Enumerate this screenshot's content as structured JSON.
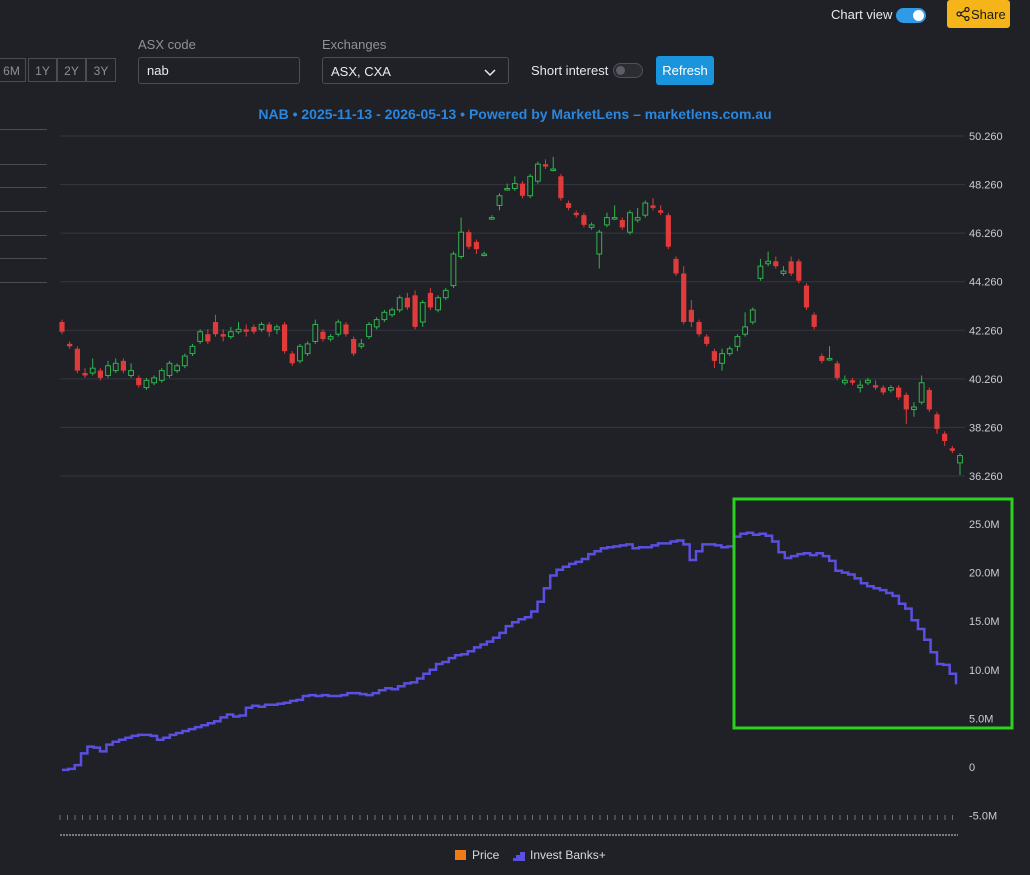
{
  "header": {
    "chart_view_label": "Chart view",
    "share_label": "Share"
  },
  "controls": {
    "ranges": [
      "6M",
      "1Y",
      "2Y",
      "3Y"
    ],
    "asx_code_label": "ASX code",
    "asx_code_value": "nab",
    "exchanges_label": "Exchanges",
    "exchanges_value": "ASX, CXA",
    "short_interest_label": "Short interest",
    "refresh_label": "Refresh"
  },
  "colors": {
    "up": "#2fb34e",
    "down": "#e03b3b",
    "line": "#5a4fe0",
    "highlight": "#2bd11d",
    "title": "#2a86de",
    "price_legend": "#f07a16"
  },
  "chart_data": [
    {
      "type": "candlestick",
      "title": "NAB • 2025-11-13 - 2026-05-13 • Powered by MarketLens – marketlens.com.au",
      "ylim": [
        36.26,
        50.26
      ],
      "y_ticks": [
        "50.260",
        "48.260",
        "46.260",
        "44.260",
        "42.260",
        "40.260",
        "38.260",
        "36.260"
      ],
      "series_name": "Price",
      "candles": [
        [
          42.6,
          42.2,
          42.7,
          42.1
        ],
        [
          41.7,
          41.6,
          41.8,
          41.5
        ],
        [
          41.5,
          40.6,
          41.6,
          40.5
        ],
        [
          40.5,
          40.4,
          40.7,
          40.3
        ],
        [
          40.5,
          40.7,
          41.1,
          40.4
        ],
        [
          40.6,
          40.3,
          40.7,
          40.2
        ],
        [
          40.4,
          40.8,
          41.0,
          40.3
        ],
        [
          40.6,
          40.9,
          41.1,
          40.5
        ],
        [
          41.0,
          40.6,
          41.1,
          40.5
        ],
        [
          40.4,
          40.6,
          40.9,
          40.3
        ],
        [
          40.3,
          40.0,
          40.4,
          39.9
        ],
        [
          39.9,
          40.2,
          40.3,
          39.8
        ],
        [
          40.1,
          40.3,
          40.4,
          40.0
        ],
        [
          40.2,
          40.6,
          40.7,
          40.1
        ],
        [
          40.4,
          40.9,
          41.0,
          40.3
        ],
        [
          40.6,
          40.8,
          40.9,
          40.5
        ],
        [
          40.8,
          41.2,
          41.3,
          40.7
        ],
        [
          41.3,
          41.6,
          41.7,
          41.2
        ],
        [
          41.8,
          42.2,
          42.3,
          41.7
        ],
        [
          42.1,
          41.8,
          42.3,
          41.7
        ],
        [
          42.6,
          42.1,
          42.9,
          42.0
        ],
        [
          42.1,
          42.0,
          42.3,
          41.8
        ],
        [
          42.0,
          42.2,
          42.4,
          41.9
        ],
        [
          42.2,
          42.3,
          42.6,
          42.1
        ],
        [
          42.3,
          42.2,
          42.5,
          42.0
        ],
        [
          42.4,
          42.2,
          42.5,
          42.1
        ],
        [
          42.3,
          42.5,
          42.6,
          42.2
        ],
        [
          42.5,
          42.2,
          42.6,
          42.0
        ],
        [
          42.3,
          42.4,
          42.5,
          42.1
        ],
        [
          42.5,
          41.4,
          42.6,
          41.3
        ],
        [
          41.3,
          40.9,
          41.4,
          40.8
        ],
        [
          41.0,
          41.6,
          41.7,
          40.9
        ],
        [
          41.3,
          41.7,
          41.8,
          41.2
        ],
        [
          41.8,
          42.5,
          42.7,
          41.7
        ],
        [
          42.2,
          41.9,
          42.3,
          41.8
        ],
        [
          41.9,
          42.0,
          42.1,
          41.8
        ],
        [
          42.1,
          42.6,
          42.7,
          42.0
        ],
        [
          42.5,
          42.1,
          42.6,
          42.0
        ],
        [
          41.9,
          41.3,
          42.0,
          41.2
        ],
        [
          41.6,
          41.7,
          41.9,
          41.5
        ],
        [
          42.0,
          42.5,
          42.6,
          41.9
        ],
        [
          42.4,
          42.7,
          42.8,
          42.3
        ],
        [
          42.7,
          43.0,
          43.1,
          42.6
        ],
        [
          42.9,
          43.1,
          43.2,
          42.8
        ],
        [
          43.1,
          43.6,
          43.7,
          43.0
        ],
        [
          43.6,
          43.2,
          43.8,
          43.1
        ],
        [
          43.7,
          42.4,
          43.9,
          42.3
        ],
        [
          42.6,
          43.4,
          43.5,
          42.4
        ],
        [
          43.8,
          43.2,
          44.0,
          43.1
        ],
        [
          43.1,
          43.6,
          43.7,
          43.0
        ],
        [
          43.6,
          43.9,
          44.0,
          43.5
        ],
        [
          44.1,
          45.4,
          45.5,
          44.0
        ],
        [
          45.3,
          46.3,
          46.9,
          45.2
        ],
        [
          46.3,
          45.7,
          46.4,
          45.6
        ],
        [
          45.9,
          45.6,
          46.0,
          45.4
        ],
        [
          45.4,
          45.4,
          45.5,
          45.3
        ],
        [
          46.9,
          46.9,
          47.0,
          46.8
        ],
        [
          47.4,
          47.8,
          47.9,
          47.2
        ],
        [
          48.1,
          48.1,
          48.3,
          48.0
        ],
        [
          48.1,
          48.3,
          48.6,
          48.0
        ],
        [
          48.3,
          47.8,
          48.4,
          47.7
        ],
        [
          47.8,
          48.6,
          48.7,
          47.7
        ],
        [
          48.4,
          49.1,
          49.2,
          48.3
        ],
        [
          49.1,
          49.0,
          49.3,
          48.9
        ],
        [
          48.9,
          48.9,
          49.4,
          48.8
        ],
        [
          48.6,
          47.7,
          48.7,
          47.6
        ],
        [
          47.5,
          47.3,
          47.6,
          47.2
        ],
        [
          47.1,
          47.0,
          47.2,
          46.9
        ],
        [
          47.0,
          46.6,
          47.1,
          46.5
        ],
        [
          46.5,
          46.6,
          46.7,
          46.4
        ],
        [
          45.4,
          46.3,
          46.4,
          44.8
        ],
        [
          46.6,
          46.9,
          47.1,
          46.5
        ],
        [
          46.9,
          46.9,
          47.4,
          46.8
        ],
        [
          46.8,
          46.5,
          46.9,
          46.4
        ],
        [
          46.3,
          47.1,
          47.2,
          46.2
        ],
        [
          46.8,
          46.9,
          47.3,
          46.7
        ],
        [
          47.0,
          47.5,
          47.6,
          46.9
        ],
        [
          47.4,
          47.3,
          47.7,
          47.2
        ],
        [
          47.2,
          47.1,
          47.4,
          47.0
        ],
        [
          47.0,
          45.7,
          47.1,
          45.6
        ],
        [
          45.2,
          44.6,
          45.3,
          44.5
        ],
        [
          44.6,
          42.6,
          44.9,
          42.5
        ],
        [
          43.1,
          42.6,
          43.5,
          42.4
        ],
        [
          42.6,
          42.1,
          42.7,
          42.0
        ],
        [
          42.0,
          41.7,
          42.1,
          41.6
        ],
        [
          41.4,
          41.0,
          41.5,
          40.7
        ],
        [
          40.9,
          41.3,
          41.5,
          40.6
        ],
        [
          41.3,
          41.5,
          41.6,
          41.2
        ],
        [
          41.6,
          42.0,
          42.1,
          41.4
        ],
        [
          42.1,
          42.4,
          43.0,
          42.0
        ],
        [
          42.6,
          43.1,
          43.2,
          42.5
        ],
        [
          44.4,
          44.9,
          45.2,
          44.3
        ],
        [
          45.0,
          45.1,
          45.5,
          44.9
        ],
        [
          45.1,
          44.9,
          45.3,
          44.8
        ],
        [
          44.6,
          44.7,
          44.9,
          44.5
        ],
        [
          45.1,
          44.6,
          45.3,
          44.5
        ],
        [
          45.1,
          44.3,
          45.2,
          44.2
        ],
        [
          44.1,
          43.2,
          44.2,
          43.1
        ],
        [
          42.9,
          42.4,
          43.0,
          42.3
        ],
        [
          41.2,
          41.0,
          41.3,
          40.9
        ],
        [
          41.1,
          41.1,
          41.6,
          41.0
        ],
        [
          40.9,
          40.3,
          41.0,
          40.2
        ],
        [
          40.1,
          40.2,
          40.4,
          40.0
        ],
        [
          40.2,
          40.1,
          40.3,
          40.0
        ],
        [
          39.9,
          40.0,
          40.2,
          39.7
        ],
        [
          40.1,
          40.2,
          40.3,
          40.0
        ],
        [
          40.0,
          39.9,
          40.2,
          39.8
        ],
        [
          39.9,
          39.7,
          40.0,
          39.6
        ],
        [
          39.8,
          39.9,
          40.0,
          39.7
        ],
        [
          39.9,
          39.5,
          40.0,
          39.4
        ],
        [
          39.6,
          39.0,
          39.7,
          38.4
        ],
        [
          39.0,
          39.1,
          39.3,
          38.7
        ],
        [
          39.3,
          40.1,
          40.4,
          39.2
        ],
        [
          39.8,
          39.0,
          39.9,
          38.9
        ],
        [
          38.8,
          38.2,
          38.9,
          38.0
        ],
        [
          38.0,
          37.7,
          38.1,
          37.5
        ],
        [
          37.4,
          37.3,
          37.5,
          37.2
        ],
        [
          36.8,
          37.1,
          37.2,
          36.3
        ]
      ]
    },
    {
      "type": "line",
      "ylim": [
        -5.0,
        27.0
      ],
      "y_ticks": [
        "25.0M",
        "20.0M",
        "15.0M",
        "10.0M",
        "5.0M",
        "0",
        "-5.0M"
      ],
      "series_name": "Invest Banks+",
      "values": [
        -0.3,
        -0.2,
        0.2,
        1.4,
        2.1,
        2.0,
        1.6,
        2.3,
        2.6,
        2.8,
        3.0,
        3.2,
        3.3,
        3.3,
        3.2,
        2.8,
        3.0,
        3.3,
        3.5,
        3.7,
        3.9,
        4.1,
        4.3,
        4.5,
        4.7,
        5.1,
        5.4,
        5.2,
        5.3,
        6.1,
        6.3,
        6.2,
        6.4,
        6.4,
        6.5,
        6.6,
        6.8,
        6.9,
        7.3,
        7.4,
        7.3,
        7.4,
        7.3,
        7.3,
        7.4,
        7.6,
        7.6,
        7.5,
        7.4,
        7.6,
        7.9,
        8.1,
        8.0,
        8.3,
        8.6,
        8.7,
        9.1,
        9.6,
        10.0,
        10.6,
        10.8,
        11.2,
        11.5,
        11.6,
        11.9,
        12.3,
        12.6,
        12.9,
        13.3,
        13.8,
        14.5,
        14.9,
        15.2,
        15.4,
        16.0,
        17.0,
        18.4,
        19.7,
        20.3,
        20.6,
        20.9,
        21.1,
        21.4,
        21.9,
        22.2,
        22.5,
        22.6,
        22.7,
        22.8,
        22.9,
        22.5,
        22.6,
        22.6,
        22.8,
        23.0,
        23.0,
        23.2,
        23.3,
        22.9,
        21.3,
        22.2,
        22.9,
        22.9,
        22.8,
        22.6,
        22.7,
        23.7,
        24.0,
        24.1,
        23.9,
        24.0,
        23.8,
        23.2,
        22.1,
        21.5,
        21.7,
        21.9,
        22.0,
        21.8,
        22.0,
        21.7,
        21.2,
        20.2,
        20.0,
        19.8,
        19.4,
        18.9,
        18.6,
        18.4,
        18.2,
        17.9,
        17.6,
        16.8,
        16.3,
        15.1,
        14.2,
        13.1,
        11.8,
        10.6,
        10.5,
        9.6,
        8.5
      ]
    }
  ],
  "legend": [
    "Price",
    "Invest Banks+"
  ]
}
